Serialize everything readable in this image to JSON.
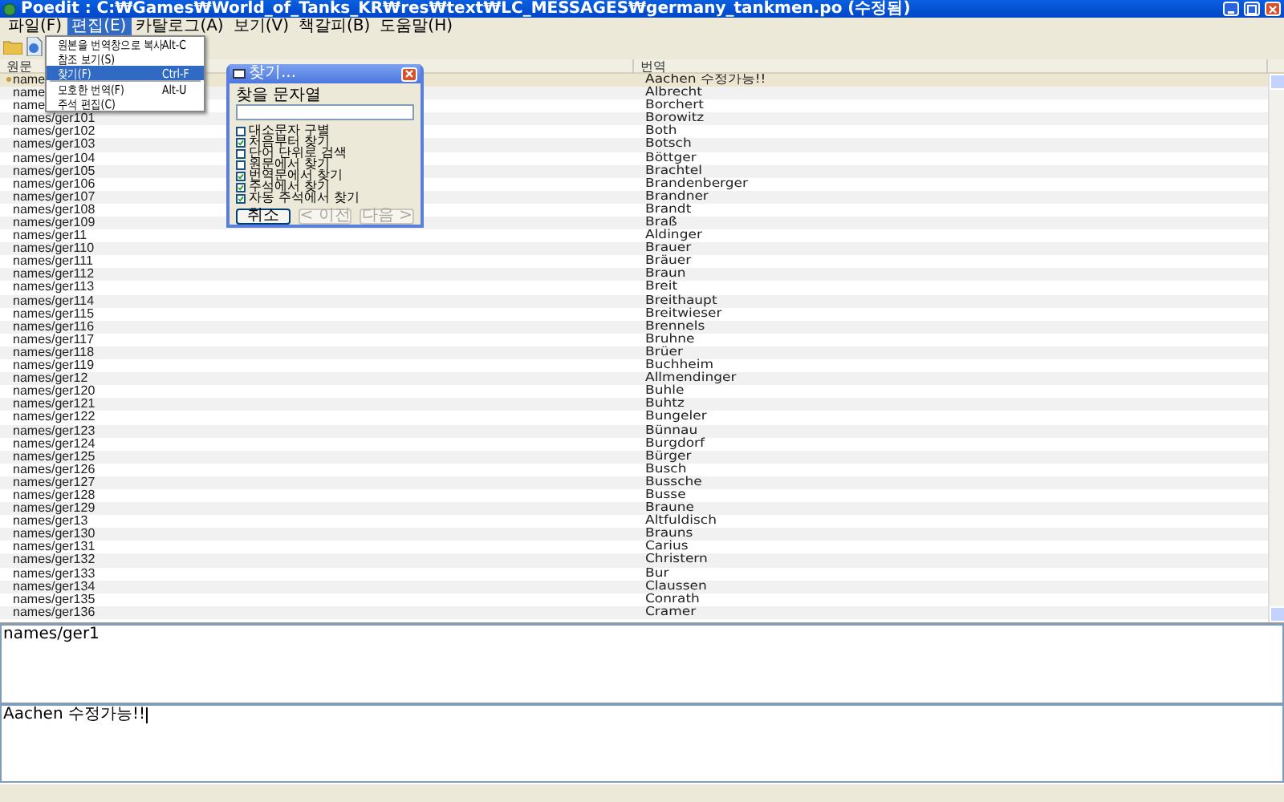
{
  "window": {
    "title": "Poedit : C:₩Games₩World_of_Tanks_KR₩res₩text₩LC_MESSAGES₩germany_tankmen.po (수정됨)"
  },
  "menu_bar": [
    {
      "label": "파일(F)",
      "selected": false
    },
    {
      "label": "편집(E)",
      "selected": true
    },
    {
      "label": "카탈로그(A)",
      "selected": false
    },
    {
      "label": "보기(V)",
      "selected": false
    },
    {
      "label": "책갈피(B)",
      "selected": false
    },
    {
      "label": "도움말(H)",
      "selected": false
    }
  ],
  "edit_menu": [
    {
      "kind": "item",
      "label": "원본을 번역창으로 복사",
      "shortcut": "Alt-C",
      "selected": false
    },
    {
      "kind": "item",
      "label": "참조 보기(S)",
      "selected": false
    },
    {
      "kind": "item",
      "label": "찾기(F)",
      "shortcut": "Ctrl-F",
      "selected": true
    },
    {
      "kind": "separator"
    },
    {
      "kind": "item",
      "label": "모호한 번역(F)",
      "shortcut": "Alt-U",
      "selected": false
    },
    {
      "kind": "item",
      "label": "주석 편집(C)",
      "selected": false
    }
  ],
  "table": {
    "columns": [
      "원문",
      "번역"
    ],
    "rows": [
      {
        "source": "name",
        "translation": "Aachen 수정가능!!",
        "selected": true
      },
      {
        "source": "name",
        "translation": "Albrecht",
        "selected": false
      },
      {
        "source": "name",
        "translation": "Borchert",
        "selected": false
      },
      {
        "source": "names/ger101",
        "translation": "Borowitz",
        "selected": false
      },
      {
        "source": "names/ger102",
        "translation": "Both",
        "selected": false
      },
      {
        "source": "names/ger103",
        "translation": "Botsch",
        "selected": false
      },
      {
        "source": "names/ger104",
        "translation": "Böttger",
        "selected": false
      },
      {
        "source": "names/ger105",
        "translation": "Brachtel",
        "selected": false
      },
      {
        "source": "names/ger106",
        "translation": "Brandenberger",
        "selected": false
      },
      {
        "source": "names/ger107",
        "translation": "Brandner",
        "selected": false
      },
      {
        "source": "names/ger108",
        "translation": "Brandt",
        "selected": false
      },
      {
        "source": "names/ger109",
        "translation": "Braß",
        "selected": false
      },
      {
        "source": "names/ger11",
        "translation": "Aldinger",
        "selected": false
      },
      {
        "source": "names/ger110",
        "translation": "Brauer",
        "selected": false
      },
      {
        "source": "names/ger111",
        "translation": "Bräuer",
        "selected": false
      },
      {
        "source": "names/ger112",
        "translation": "Braun",
        "selected": false
      },
      {
        "source": "names/ger113",
        "translation": "Breit",
        "selected": false
      },
      {
        "source": "names/ger114",
        "translation": "Breithaupt",
        "selected": false
      },
      {
        "source": "names/ger115",
        "translation": "Breitwieser",
        "selected": false
      },
      {
        "source": "names/ger116",
        "translation": "Brennels",
        "selected": false
      },
      {
        "source": "names/ger117",
        "translation": "Bruhne",
        "selected": false
      },
      {
        "source": "names/ger118",
        "translation": "Brüer",
        "selected": false
      },
      {
        "source": "names/ger119",
        "translation": "Buchheim",
        "selected": false
      },
      {
        "source": "names/ger12",
        "translation": "Allmendinger",
        "selected": false
      },
      {
        "source": "names/ger120",
        "translation": "Buhle",
        "selected": false
      },
      {
        "source": "names/ger121",
        "translation": "Buhtz",
        "selected": false
      },
      {
        "source": "names/ger122",
        "translation": "Bungeler",
        "selected": false
      },
      {
        "source": "names/ger123",
        "translation": "Bünnau",
        "selected": false
      },
      {
        "source": "names/ger124",
        "translation": "Burgdorf",
        "selected": false
      },
      {
        "source": "names/ger125",
        "translation": "Bürger",
        "selected": false
      },
      {
        "source": "names/ger126",
        "translation": "Busch",
        "selected": false
      },
      {
        "source": "names/ger127",
        "translation": "Bussche",
        "selected": false
      },
      {
        "source": "names/ger128",
        "translation": "Busse",
        "selected": false
      },
      {
        "source": "names/ger129",
        "translation": "Braune",
        "selected": false
      },
      {
        "source": "names/ger13",
        "translation": "Altfuldisch",
        "selected": false
      },
      {
        "source": "names/ger130",
        "translation": "Brauns",
        "selected": false
      },
      {
        "source": "names/ger131",
        "translation": "Carius",
        "selected": false
      },
      {
        "source": "names/ger132",
        "translation": "Christern",
        "selected": false
      },
      {
        "source": "names/ger133",
        "translation": "Bur",
        "selected": false
      },
      {
        "source": "names/ger134",
        "translation": "Claussen",
        "selected": false
      },
      {
        "source": "names/ger135",
        "translation": "Conrath",
        "selected": false
      },
      {
        "source": "names/ger136",
        "translation": "Cramer",
        "selected": false
      }
    ]
  },
  "find_dialog": {
    "title": "찾기...",
    "label": "찾을 문자열",
    "options": [
      {
        "label": "대소문자 구별",
        "checked": false
      },
      {
        "label": "처음부터 찾기",
        "checked": true
      },
      {
        "label": "단어 단위로 검색",
        "checked": false
      },
      {
        "label": "원문에서 찾기",
        "checked": false
      },
      {
        "label": "번역문에서 찾기",
        "checked": true
      },
      {
        "label": "주석에서 찾기",
        "checked": true
      },
      {
        "label": "자동 주석에서 찾기",
        "checked": true
      }
    ],
    "buttons": [
      {
        "label": "취소",
        "disabled": false
      },
      {
        "label": "< 이전",
        "disabled": true
      },
      {
        "label": "다음 >",
        "disabled": true
      }
    ]
  },
  "source_pane": {
    "value": "names/ger1"
  },
  "translation_pane": {
    "value": "Aachen 수정가능!!"
  }
}
